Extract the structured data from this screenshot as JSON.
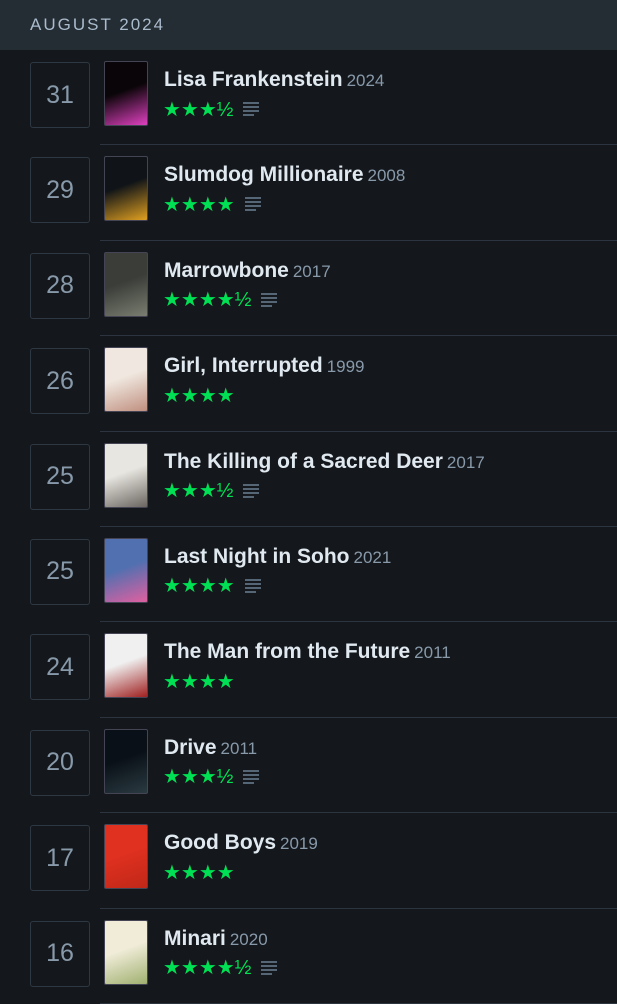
{
  "header": {
    "month": "AUGUST 2024"
  },
  "colors": {
    "accent_green": "#00e054",
    "background": "#14181c",
    "header_bg": "#242c34"
  },
  "entries": [
    {
      "day": "31",
      "title": "Lisa Frankenstein",
      "year": "2024",
      "stars": "★★★½",
      "rating": 3.5,
      "has_review": true,
      "poster_colors": [
        "#0a0508",
        "#e040c0"
      ],
      "poster_text": ""
    },
    {
      "day": "29",
      "title": "Slumdog Millionaire",
      "year": "2008",
      "stars": "★★★★",
      "rating": 4,
      "has_review": true,
      "poster_colors": [
        "#101418",
        "#e0a020"
      ],
      "poster_text": ""
    },
    {
      "day": "28",
      "title": "Marrowbone",
      "year": "2017",
      "stars": "★★★★½",
      "rating": 4.5,
      "has_review": true,
      "poster_colors": [
        "#3a3d38",
        "#7a7d70"
      ],
      "poster_text": ""
    },
    {
      "day": "26",
      "title": "Girl, Interrupted",
      "year": "1999",
      "stars": "★★★★",
      "rating": 4,
      "has_review": false,
      "poster_colors": [
        "#f0e8e0",
        "#c09080"
      ],
      "poster_text": ""
    },
    {
      "day": "25",
      "title": "The Killing of a Sacred Deer",
      "year": "2017",
      "stars": "★★★½",
      "rating": 3.5,
      "has_review": true,
      "poster_colors": [
        "#e8e6e0",
        "#6a6560"
      ],
      "poster_text": ""
    },
    {
      "day": "25",
      "title": "Last Night in Soho",
      "year": "2021",
      "stars": "★★★★",
      "rating": 4,
      "has_review": true,
      "poster_colors": [
        "#5070b0",
        "#e060a0"
      ],
      "poster_text": ""
    },
    {
      "day": "24",
      "title": "The Man from the Future",
      "year": "2011",
      "stars": "★★★★",
      "rating": 4,
      "has_review": false,
      "poster_colors": [
        "#f0f0f0",
        "#a02020"
      ],
      "poster_text": ""
    },
    {
      "day": "20",
      "title": "Drive",
      "year": "2011",
      "stars": "★★★½",
      "rating": 3.5,
      "has_review": true,
      "poster_colors": [
        "#0a1018",
        "#2a3a40"
      ],
      "poster_text": ""
    },
    {
      "day": "17",
      "title": "Good Boys",
      "year": "2019",
      "stars": "★★★★",
      "rating": 4,
      "has_review": false,
      "poster_colors": [
        "#e03020",
        "#c02818"
      ],
      "poster_text": ""
    },
    {
      "day": "16",
      "title": "Minari",
      "year": "2020",
      "stars": "★★★★½",
      "rating": 4.5,
      "has_review": true,
      "poster_colors": [
        "#f0ecd8",
        "#a0b070"
      ],
      "poster_text": ""
    }
  ]
}
